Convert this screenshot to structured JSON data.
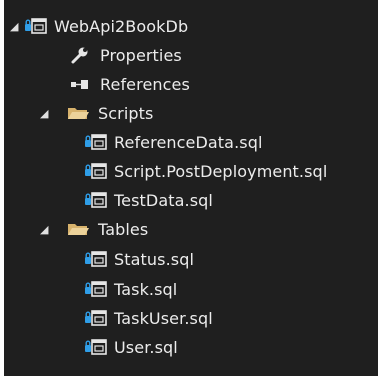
{
  "tree": {
    "project": {
      "label": "WebApi2BookDb",
      "icon": "database-project-icon"
    },
    "properties": {
      "label": "Properties",
      "icon": "wrench-icon"
    },
    "references": {
      "label": "References",
      "icon": "references-icon"
    },
    "scripts": {
      "label": "Scripts",
      "icon": "folder-open-icon",
      "files": [
        {
          "label": "ReferenceData.sql",
          "icon": "sql-file-icon"
        },
        {
          "label": "Script.PostDeployment.sql",
          "icon": "sql-file-icon"
        },
        {
          "label": "TestData.sql",
          "icon": "sql-file-icon"
        }
      ]
    },
    "tables": {
      "label": "Tables",
      "icon": "folder-open-icon",
      "files": [
        {
          "label": "Status.sql",
          "icon": "sql-file-icon"
        },
        {
          "label": "Task.sql",
          "icon": "sql-file-icon"
        },
        {
          "label": "TaskUser.sql",
          "icon": "sql-file-icon"
        },
        {
          "label": "User.sql",
          "icon": "sql-file-icon"
        }
      ]
    }
  },
  "colors": {
    "background": "#1f1f1f",
    "text": "#ececec",
    "lock": "#2f9ee8",
    "folder": "#d7b26c"
  }
}
